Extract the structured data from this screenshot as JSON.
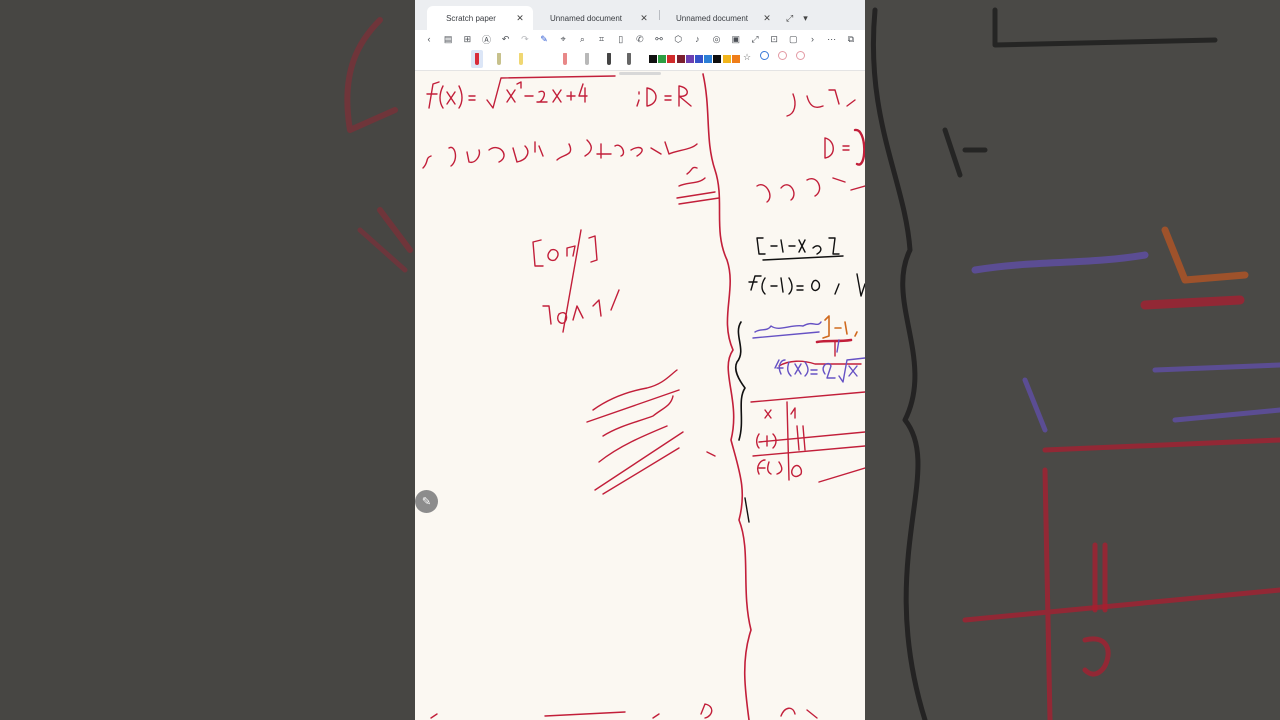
{
  "tabs": [
    {
      "label": "Scratch paper",
      "active": true,
      "close": "✕"
    },
    {
      "label": "Unnamed document",
      "active": false,
      "close": "✕"
    },
    {
      "label": "Unnamed document",
      "active": false,
      "close": "✕"
    }
  ],
  "tab_controls": {
    "expand": "⤢",
    "dropdown": "▾"
  },
  "toolbar": {
    "back": "‹",
    "sidebar": "▤",
    "grid": "⊞",
    "text": "Ⓐ",
    "undo": "↶",
    "redo": "↷",
    "pen": "✎",
    "highlighter": "⌖",
    "lasso": "⌕",
    "crop": "⌗",
    "ruler": "▯",
    "comment": "✆",
    "link": "⚯",
    "shapes": "⬡",
    "mic": "♪",
    "target": "◎",
    "image": "▣",
    "expand": "⤢",
    "add": "⊡",
    "box": "▢",
    "next": "›",
    "more": "⋯",
    "pages": "⧉"
  },
  "palette": {
    "colors": [
      "#111111",
      "#2e9e43",
      "#d12b2b",
      "#7b1f2e",
      "#6c3fb0",
      "#3552c9",
      "#2c7fd6",
      "#0f0f0f",
      "#f2b51b",
      "#ef7d19"
    ],
    "star": "☆"
  },
  "edit_button": {
    "icon": "✎"
  },
  "accent": "#c21f3a"
}
